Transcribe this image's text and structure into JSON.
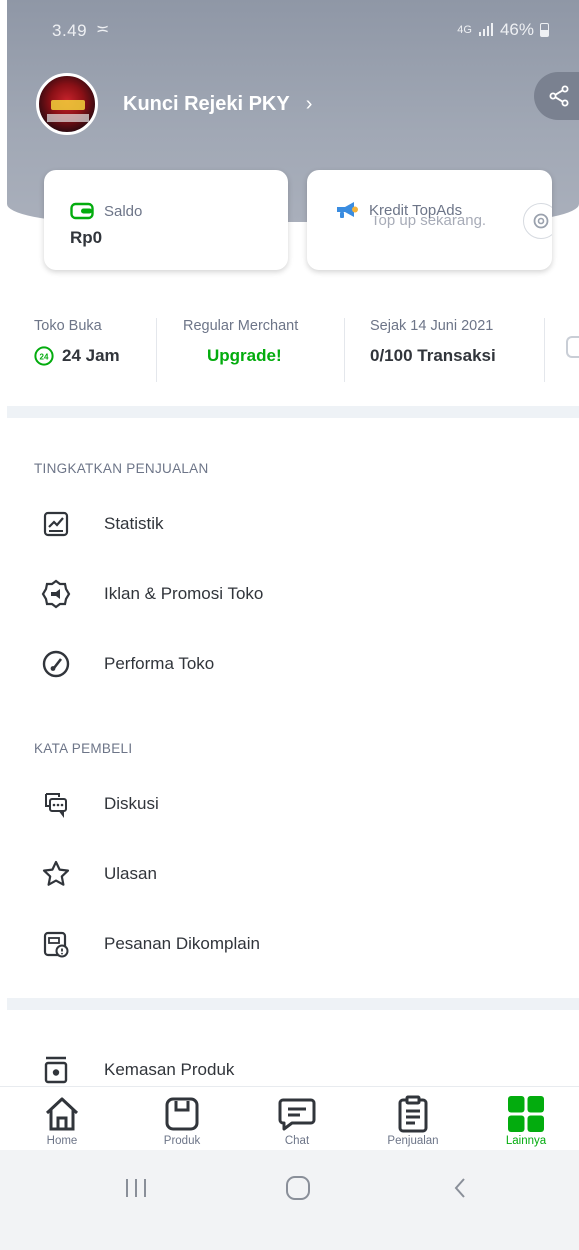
{
  "status_bar": {
    "time": "3.49",
    "network": "4G",
    "battery": "46%"
  },
  "shop": {
    "name": "Kunci Rejeki PKY",
    "chevron": "›"
  },
  "cards": {
    "saldo": {
      "label": "Saldo",
      "value": "Rp0"
    },
    "topads": {
      "label": "Kredit TopAds",
      "subtext": "Top up sekarang."
    }
  },
  "stats": [
    {
      "label": "Toko Buka",
      "value": "24 Jam"
    },
    {
      "label": "Regular Merchant",
      "value": "Upgrade!"
    },
    {
      "label": "Sejak 14 Juni 2021",
      "value": "0/100 Transaksi"
    }
  ],
  "sections": {
    "tingkatkan": {
      "title": "TINGKATKAN PENJUALAN",
      "items": [
        "Statistik",
        "Iklan & Promosi Toko",
        "Performa Toko"
      ]
    },
    "kata_pembeli": {
      "title": "KATA PEMBELI",
      "items": [
        "Diskusi",
        "Ulasan",
        "Pesanan Dikomplain"
      ]
    },
    "other": {
      "items": [
        "Kemasan Produk"
      ]
    }
  },
  "bottom_nav": [
    {
      "label": "Home",
      "icon": "home-icon"
    },
    {
      "label": "Produk",
      "icon": "product-box-icon"
    },
    {
      "label": "Chat",
      "icon": "chat-icon"
    },
    {
      "label": "Penjualan",
      "icon": "clipboard-icon"
    },
    {
      "label": "Lainnya",
      "icon": "grid-icon",
      "active": true
    }
  ],
  "colors": {
    "accent": "#03ac0e",
    "header": "#9ba2af",
    "text": "#31353b",
    "muted": "#6d7588"
  }
}
